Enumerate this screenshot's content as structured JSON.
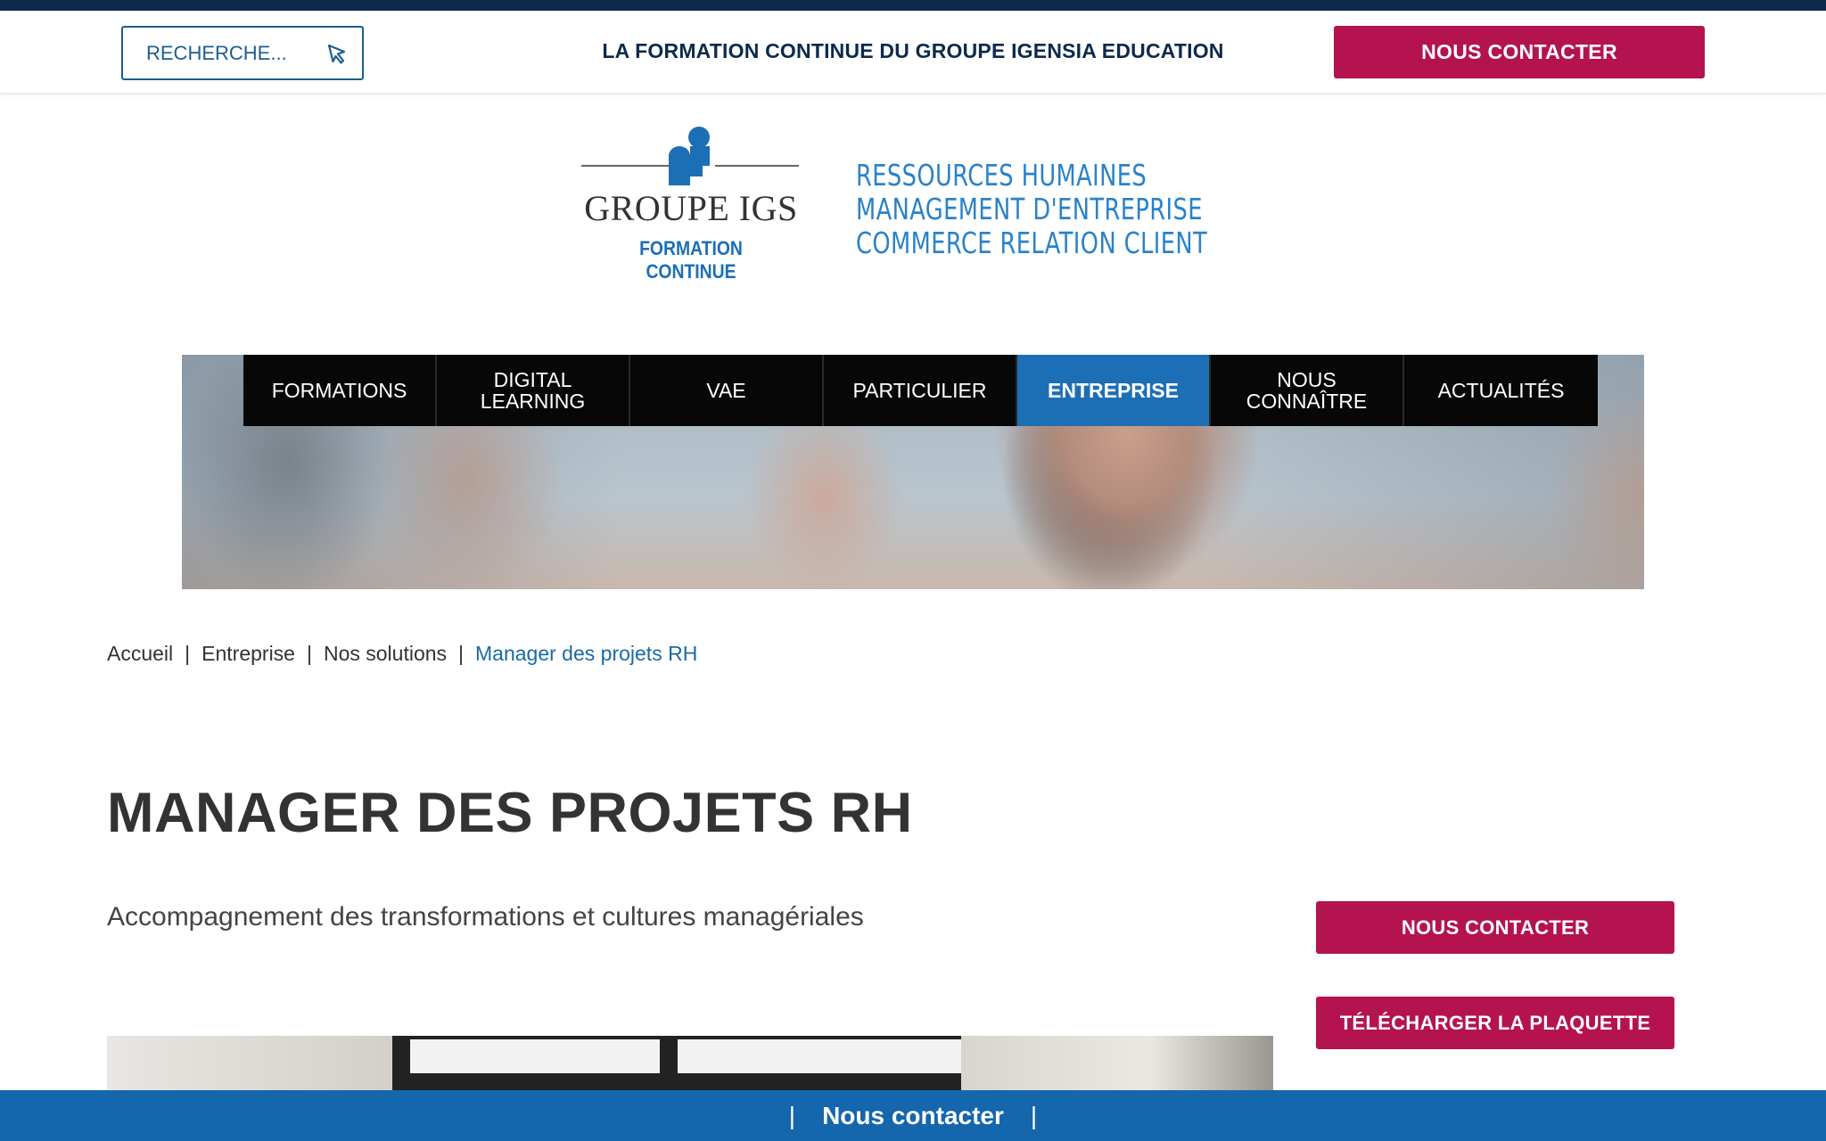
{
  "header": {
    "search_placeholder": "RECHERCHE...",
    "tagline": "LA FORMATION CONTINUE DU GROUPE IGENSIA EDUCATION",
    "contact_label": "NOUS CONTACTER"
  },
  "logo": {
    "name": "GROUPE IGS",
    "subtitle": "FORMATION CONTINUE",
    "domains": [
      "RESSOURCES HUMAINES",
      "MANAGEMENT D'ENTREPRISE",
      "COMMERCE RELATION CLIENT"
    ]
  },
  "nav": {
    "items": [
      {
        "label": "FORMATIONS"
      },
      {
        "label": "DIGITAL LEARNING"
      },
      {
        "label": "VAE"
      },
      {
        "label": "PARTICULIER"
      },
      {
        "label": "ENTREPRISE",
        "active": true
      },
      {
        "label": "NOUS CONNAÎTRE"
      },
      {
        "label": "ACTUALITÉS"
      }
    ]
  },
  "breadcrumb": {
    "items": [
      "Accueil",
      "Entreprise",
      "Nos solutions",
      "Manager des projets RH"
    ],
    "separator": "|"
  },
  "main": {
    "title": "MANAGER DES PROJETS RH",
    "subtitle": "Accompagnement des transformations et cultures managériales"
  },
  "sidebar": {
    "contact_label": "NOUS CONTACTER",
    "download_label": "TÉLÉCHARGER LA PLAQUETTE"
  },
  "footer_bar": {
    "label": "Nous contacter",
    "pipe": "|"
  },
  "colors": {
    "brand_red": "#b5134f",
    "brand_blue": "#1c6fb5",
    "navy": "#0d2a4a",
    "nav_black": "#070707"
  }
}
